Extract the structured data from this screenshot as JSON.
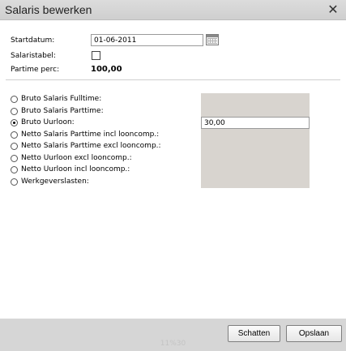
{
  "dialog": {
    "title": "Salaris bewerken",
    "close_icon": "close-icon"
  },
  "form": {
    "startdatum_label": "Startdatum:",
    "startdatum_value": "01-06-2011",
    "salaristabel_label": "Salaristabel:",
    "salaristabel_checked": false,
    "partime_label": "Partime perc:",
    "partime_value": "100,00"
  },
  "options": [
    {
      "label": "Bruto Salaris Fulltime:",
      "selected": false,
      "value": ""
    },
    {
      "label": "Bruto Salaris Parttime:",
      "selected": false,
      "value": ""
    },
    {
      "label": "Bruto Uurloon:",
      "selected": true,
      "value": "30,00"
    },
    {
      "label": "Netto Salaris Parttime incl looncomp.:",
      "selected": false,
      "value": ""
    },
    {
      "label": "Netto Salaris Parttime excl looncomp.:",
      "selected": false,
      "value": ""
    },
    {
      "label": "Netto Uurloon excl looncomp.:",
      "selected": false,
      "value": ""
    },
    {
      "label": "Netto Uurloon incl looncomp.:",
      "selected": false,
      "value": ""
    },
    {
      "label": "Werkgeverslasten:",
      "selected": false,
      "value": ""
    }
  ],
  "footer": {
    "schatten_label": "Schatten",
    "opslaan_label": "Opslaan",
    "status_text": "11%30"
  }
}
